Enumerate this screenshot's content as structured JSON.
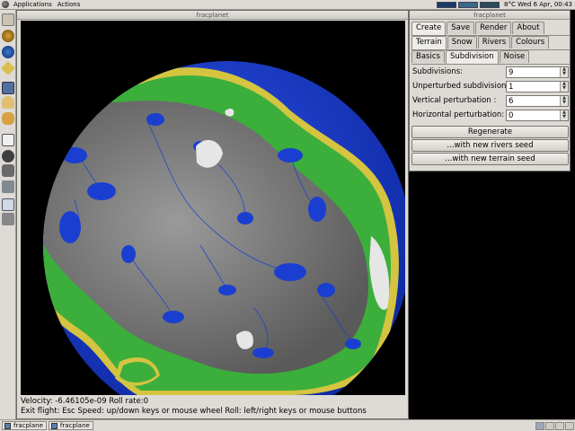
{
  "top_panel": {
    "menus": [
      "Applications",
      "Actions"
    ],
    "clock": "8°C Wed 6 Apr, 00:43"
  },
  "render_window": {
    "title": "fracplanet",
    "status_line1": "Velocity: -6.46105e-09  Roll rate:0",
    "status_line2": "Exit flight: Esc  Speed: up/down keys or mouse wheel  Roll: left/right keys or mouse buttons"
  },
  "control_window": {
    "title": "fracplanet",
    "tabs_main": [
      "Create",
      "Save",
      "Render",
      "About"
    ],
    "tabs_create": [
      "Terrain",
      "Snow",
      "Rivers",
      "Colours"
    ],
    "tabs_terrain": [
      "Basics",
      "Subdivision",
      "Noise"
    ],
    "fields": [
      {
        "label": "Subdivisions:",
        "value": "9"
      },
      {
        "label": "Unperturbed subdivisions:",
        "value": "1"
      },
      {
        "label": "Vertical perturbation :",
        "value": "6"
      },
      {
        "label": "Horizontal perturbation:",
        "value": "0"
      }
    ],
    "buttons": [
      "Regenerate",
      "...with new rivers seed",
      "...with new terrain seed"
    ]
  },
  "taskbar": {
    "tasks": [
      "fracplane",
      "fracplane"
    ]
  },
  "colors": {
    "ocean": "#1a3fd0",
    "land": "#3fb040",
    "mountain": "#8a8a8a",
    "snow": "#e8e8e8",
    "beach": "#d8c840"
  }
}
